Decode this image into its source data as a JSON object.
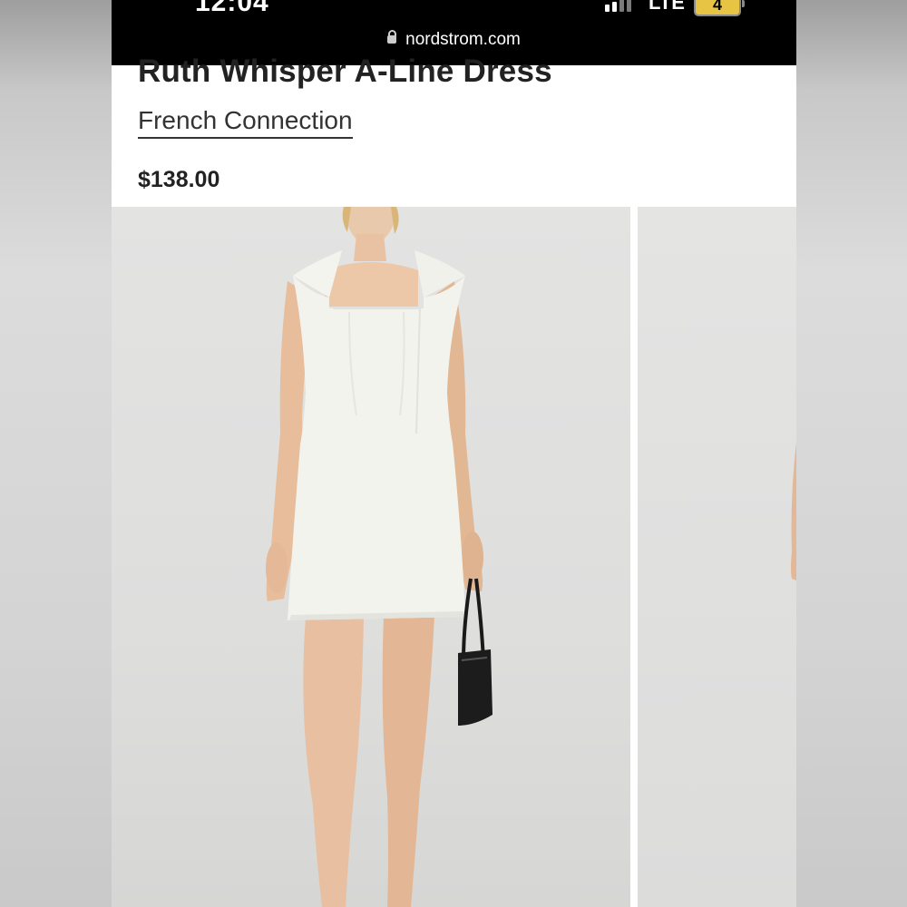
{
  "status_bar": {
    "time": "12:04",
    "network": "LTE",
    "battery": "4"
  },
  "browser": {
    "url": "nordstrom.com"
  },
  "product": {
    "title": "Ruth Whisper A-Line Dress",
    "brand": "French Connection",
    "price": "$138.00"
  },
  "icons": {
    "lock": "lock-icon",
    "signal": "signal-bars-icon",
    "battery": "battery-icon"
  },
  "colors": {
    "status_bar_bg": "#000000",
    "battery_fill": "#e8c445",
    "text_primary": "#222222"
  }
}
